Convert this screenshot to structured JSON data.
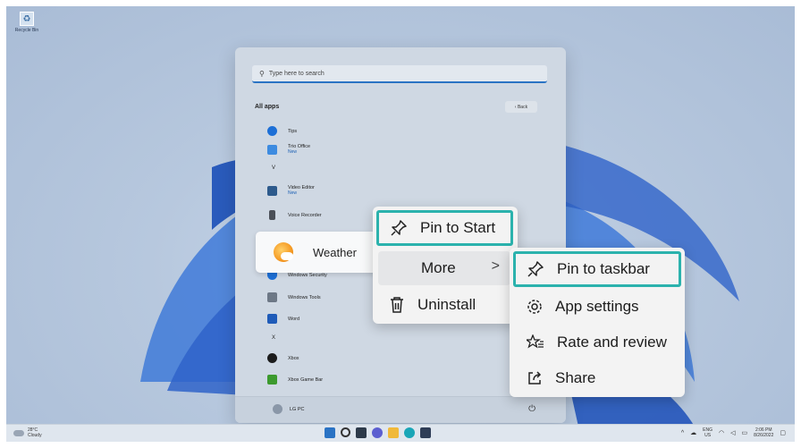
{
  "desktop": {
    "recycle_bin_label": "Recycle Bin"
  },
  "start_menu": {
    "search_placeholder": "Type here to search",
    "section_title": "All apps",
    "back_label": "Back",
    "apps": [
      {
        "name": "Tips",
        "sub": ""
      },
      {
        "name": "Trio Office",
        "sub": "New"
      },
      {
        "letter": "V"
      },
      {
        "name": "Video Editor",
        "sub": "New"
      },
      {
        "name": "Voice Recorder",
        "sub": ""
      },
      {
        "name": "Windows Security",
        "sub": ""
      },
      {
        "name": "Windows Tools",
        "sub": ""
      },
      {
        "name": "Word",
        "sub": ""
      },
      {
        "letter": "X"
      },
      {
        "name": "Xbox",
        "sub": ""
      },
      {
        "name": "Xbox Game Bar",
        "sub": ""
      }
    ],
    "user_name": "LG PC"
  },
  "weather_item": {
    "label": "Weather"
  },
  "context_menu": {
    "pin_to_start": "Pin to Start",
    "more": "More",
    "more_chevron": ">",
    "uninstall": "Uninstall"
  },
  "submenu": {
    "pin_to_taskbar": "Pin to taskbar",
    "app_settings": "App settings",
    "rate_and_review": "Rate and review",
    "share": "Share"
  },
  "taskbar": {
    "temperature": "28°C",
    "condition": "Cloudy",
    "lang_1": "ENG",
    "lang_2": "US",
    "time": "2:06 PM",
    "date": "8/26/2022"
  },
  "colors": {
    "highlight": "#2bb2ad",
    "accent": "#2a73c4"
  }
}
